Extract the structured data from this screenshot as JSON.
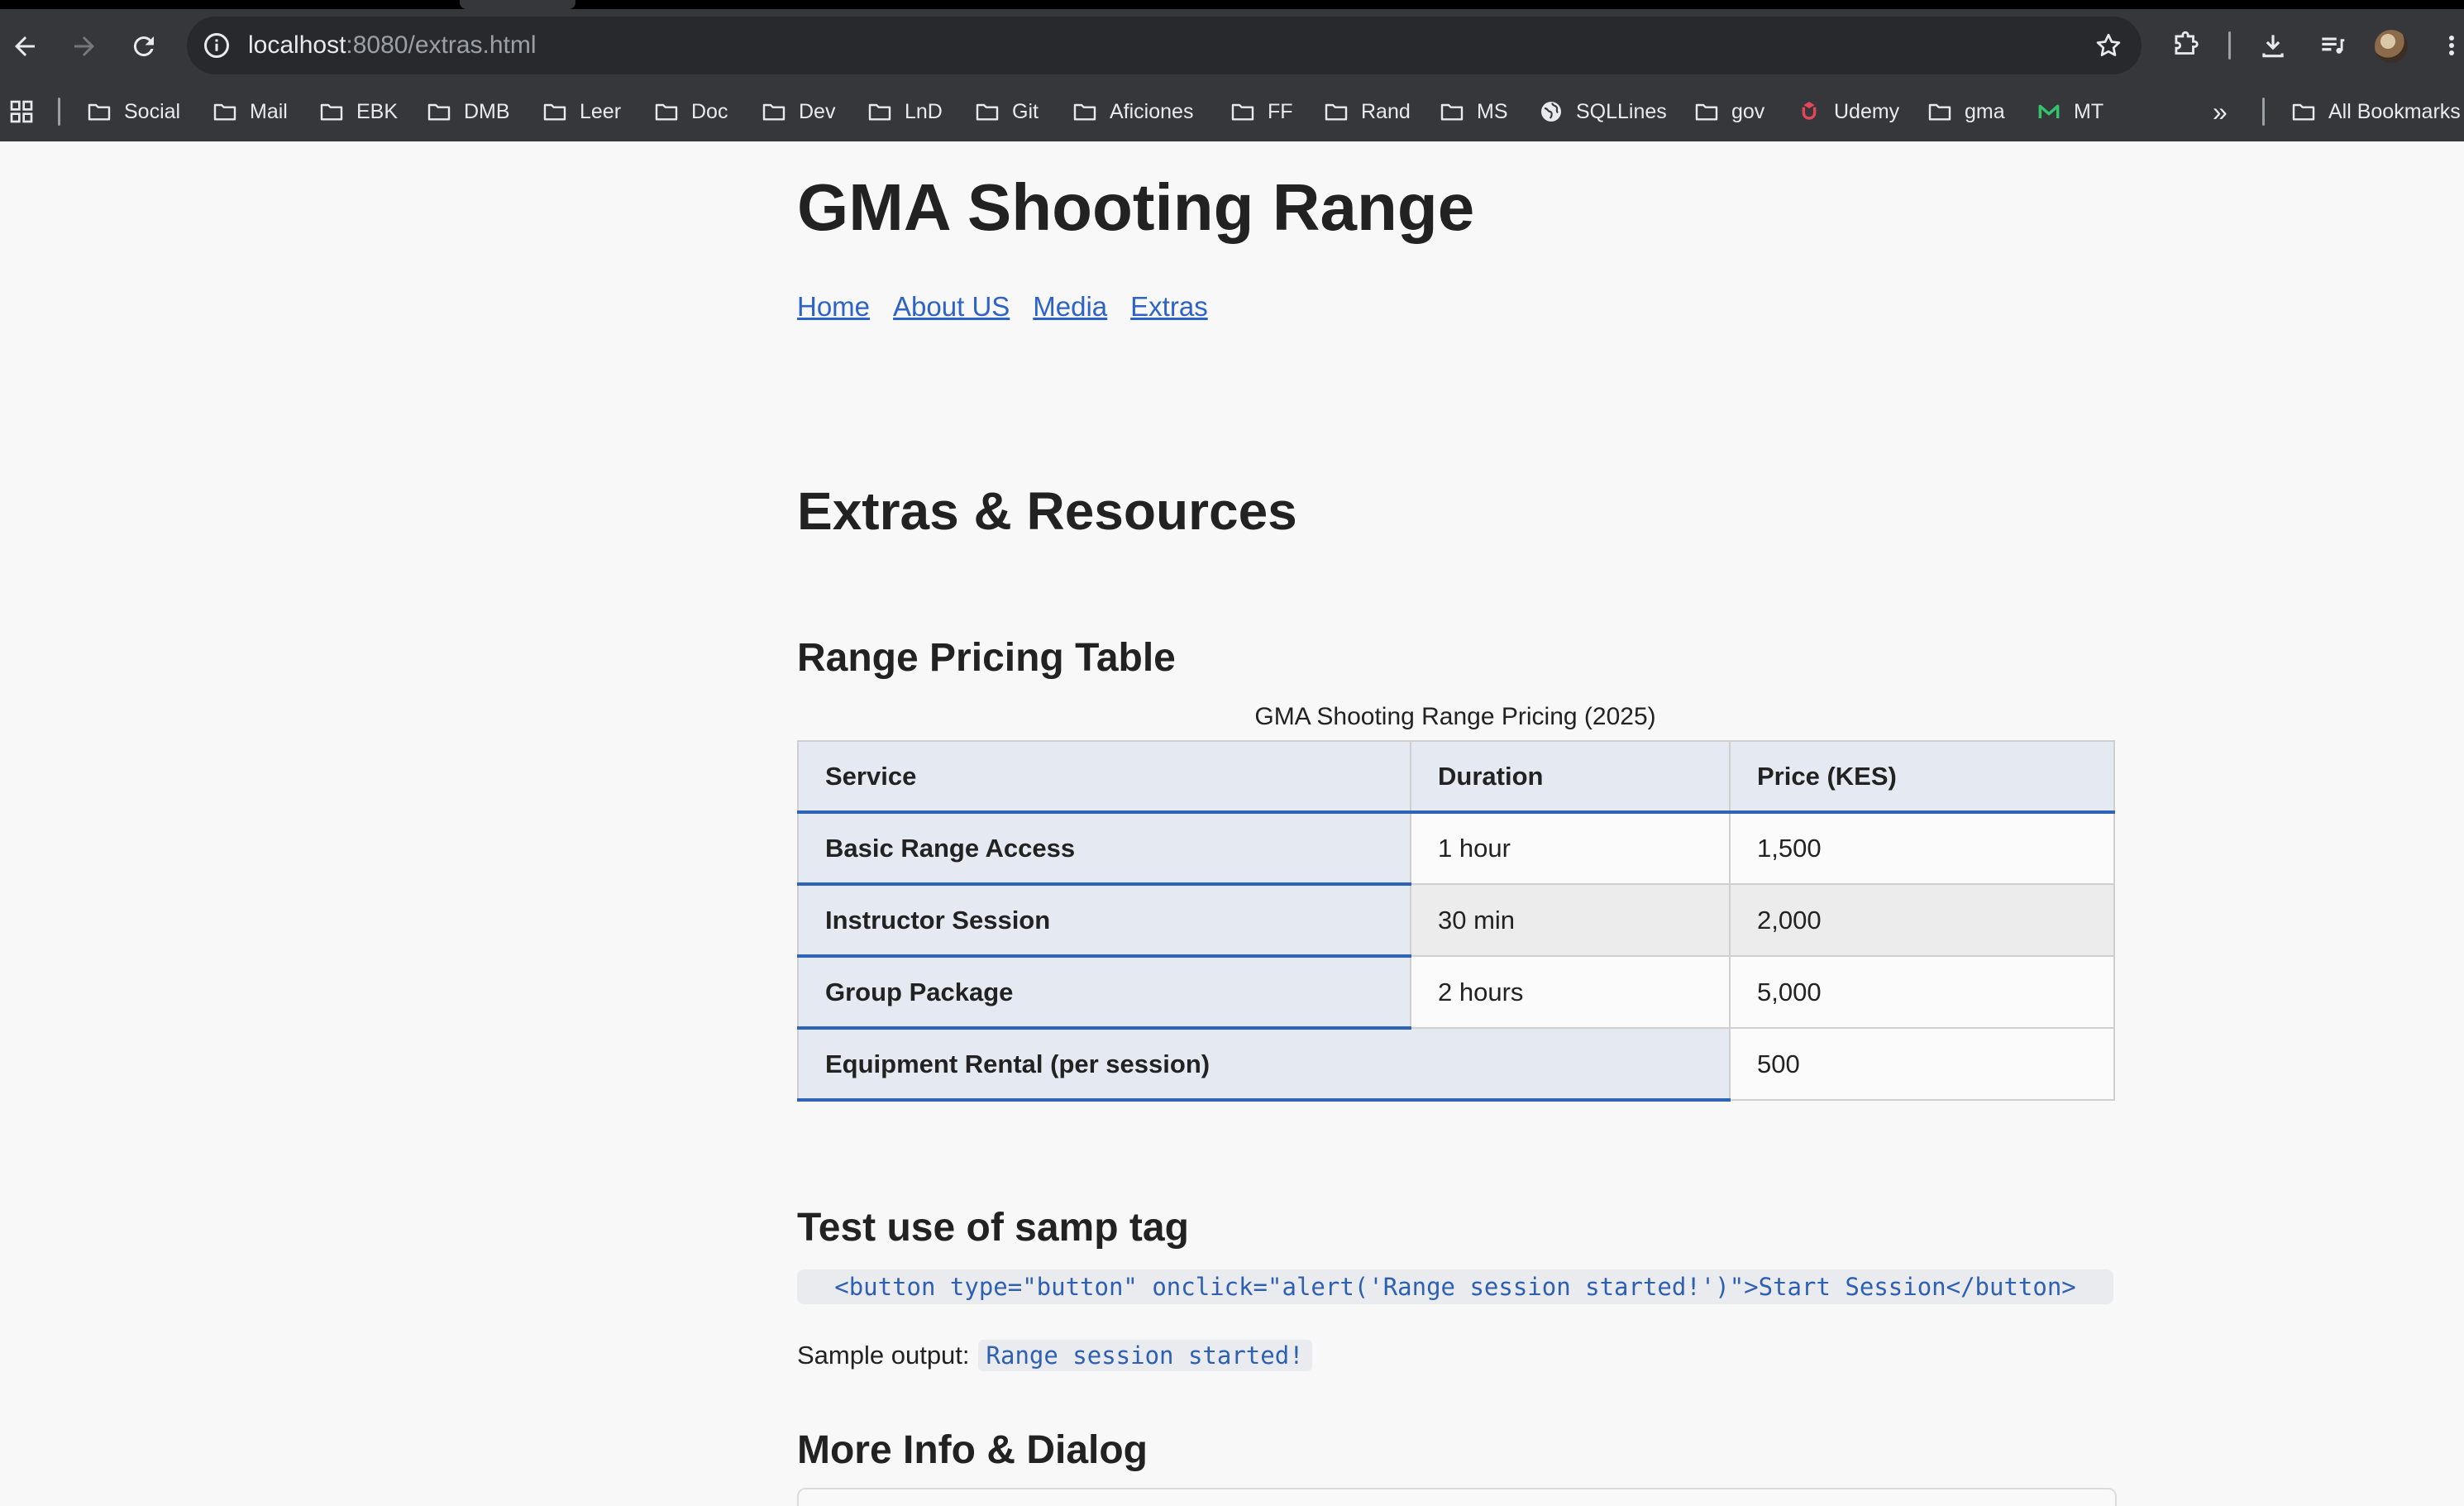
{
  "browser": {
    "url_host": "localhost",
    "url_path": ":8080/extras.html",
    "bookmarks": [
      {
        "label": "Social",
        "icon": "folder-icon"
      },
      {
        "label": "Mail",
        "icon": "folder-icon"
      },
      {
        "label": "EBK",
        "icon": "folder-icon"
      },
      {
        "label": "DMB",
        "icon": "folder-icon"
      },
      {
        "label": "Leer",
        "icon": "folder-icon"
      },
      {
        "label": "Doc",
        "icon": "folder-icon"
      },
      {
        "label": "Dev",
        "icon": "folder-icon"
      },
      {
        "label": "LnD",
        "icon": "folder-icon"
      },
      {
        "label": "Git",
        "icon": "folder-icon"
      },
      {
        "label": "Aficiones",
        "icon": "folder-icon"
      },
      {
        "label": "FF",
        "icon": "folder-icon"
      },
      {
        "label": "Rand",
        "icon": "folder-icon"
      },
      {
        "label": "MS",
        "icon": "folder-icon"
      },
      {
        "label": "SQLLines",
        "icon": "globe-icon"
      },
      {
        "label": "gov",
        "icon": "folder-icon"
      },
      {
        "label": "Udemy",
        "icon": "udemy-icon"
      },
      {
        "label": "gma",
        "icon": "folder-icon"
      },
      {
        "label": "MT",
        "icon": "m-logo-icon"
      }
    ],
    "all_bookmarks_label": "All Bookmarks",
    "overflow_label": "»"
  },
  "site": {
    "title": "GMA Shooting Range",
    "nav": [
      "Home",
      "About US",
      "Media",
      "Extras"
    ]
  },
  "main": {
    "heading": "Extras & Resources",
    "pricing": {
      "heading": "Range Pricing Table",
      "caption": "GMA Shooting Range Pricing (2025)",
      "columns": [
        "Service",
        "Duration",
        "Price (KES)"
      ],
      "rows": [
        {
          "service": "Basic Range Access",
          "duration": "1 hour",
          "price": "1,500"
        },
        {
          "service": "Instructor Session",
          "duration": "30 min",
          "price": "2,000"
        },
        {
          "service": "Group Package",
          "duration": "2 hours",
          "price": "5,000"
        },
        {
          "service": "Equipment Rental (per session)",
          "price": "500"
        }
      ]
    },
    "samp": {
      "heading": "Test use of samp tag",
      "code": "<button type=\"button\" onclick=\"alert('Range session started!')\">Start Session</button>",
      "sample_label": "Sample output:",
      "sample_output": "Range session started!"
    },
    "more": {
      "heading": "More Info & Dialog"
    }
  },
  "colors": {
    "link": "#2d63c8",
    "table_header_bg": "#e4e9f2",
    "table_accent": "#2f63b6",
    "code_text": "#2d5fb3",
    "code_bg": "#e9ebef",
    "page_bg": "#f8f8f8",
    "chrome_bg": "#36373a"
  }
}
